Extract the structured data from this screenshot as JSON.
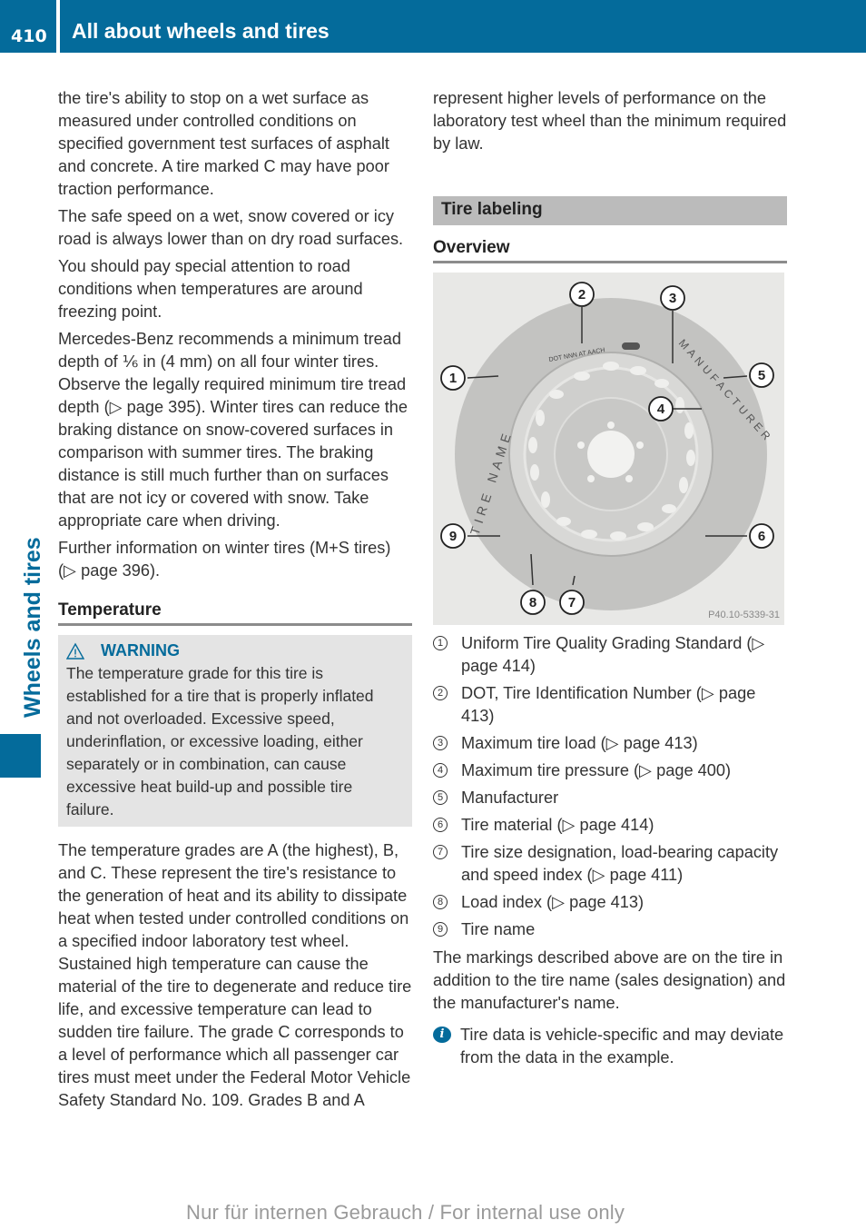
{
  "header": {
    "page_number": "410",
    "title": "All about wheels and tires"
  },
  "side_tab": {
    "label": "Wheels and tires"
  },
  "left_column": {
    "paragraphs_top": [
      "the tire's ability to stop on a wet surface as measured under controlled conditions on specified government test surfaces of asphalt and concrete. A tire marked C may have poor traction performance.",
      "The safe speed on a wet, snow covered or icy road is always lower than on dry road surfaces.",
      "You should pay special attention to road conditions when temperatures are around freezing point.",
      "Mercedes-Benz recommends a minimum tread depth of ⅙ in (4 mm) on all four winter tires. Observe the legally required minimum tire tread depth (▷ page 395). Winter tires can reduce the braking distance on snow-covered surfaces in comparison with summer tires. The braking distance is still much further than on surfaces that are not icy or covered with snow. Take appropriate care when driving.",
      "Further information on winter tires (M+S tires) (▷ page 396)."
    ],
    "temperature_heading": "Temperature",
    "warning": {
      "label": "WARNING",
      "text": "The temperature grade for this tire is established for a tire that is properly inflated and not overloaded. Excessive speed, underinflation, or excessive loading, either separately or in combination, can cause excessive heat build-up and possible tire failure."
    },
    "temperature_paragraph": "The temperature grades are A (the highest), B, and C. These represent the tire's resistance to the generation of heat and its ability to dissipate heat when tested under controlled conditions on a specified indoor laboratory test wheel. Sustained high temperature can cause the material of the tire to degenerate and reduce tire life, and excessive temperature can lead to sudden tire failure. The grade C corresponds to a level of performance which all passenger car tires must meet under the Federal Motor Vehicle Safety Standard No. 109. Grades B and A"
  },
  "right_column": {
    "paragraph_top": "represent higher levels of performance on the laboratory test wheel than the minimum required by law.",
    "section_title": "Tire labeling",
    "overview_heading": "Overview",
    "figure": {
      "code": "P40.10-5339-31",
      "sidewall_texts": {
        "tire_name": "TIRE NAME",
        "manufacturer": "MANUFACTURER",
        "dot": "DOT NNN AT AACH"
      },
      "callouts": [
        "1",
        "2",
        "3",
        "4",
        "5",
        "6",
        "7",
        "8",
        "9"
      ]
    },
    "legend": [
      {
        "num": "1",
        "text": "Uniform Tire Quality Grading Standard (▷ page 414)"
      },
      {
        "num": "2",
        "text": "DOT, Tire Identification Number (▷ page 413)"
      },
      {
        "num": "3",
        "text": "Maximum tire load (▷ page 413)"
      },
      {
        "num": "4",
        "text": "Maximum tire pressure (▷ page 400)"
      },
      {
        "num": "5",
        "text": "Manufacturer"
      },
      {
        "num": "6",
        "text": "Tire material (▷ page 414)"
      },
      {
        "num": "7",
        "text": "Tire size designation, load-bearing capacity and speed index (▷ page 411)"
      },
      {
        "num": "8",
        "text": "Load index (▷ page 413)"
      },
      {
        "num": "9",
        "text": "Tire name"
      }
    ],
    "markings_paragraph": "The markings described above are on the tire in addition to the tire name (sales designation) and the manufacturer's name.",
    "info": {
      "icon": "i",
      "text": "Tire data is vehicle-specific and may deviate from the data in the example."
    }
  },
  "footer": {
    "watermark": "Nur für internen Gebrauch / For internal use only"
  }
}
